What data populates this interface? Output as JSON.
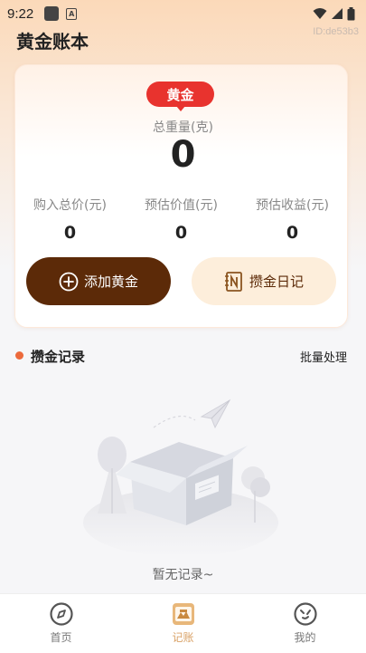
{
  "status_bar": {
    "time": "9:22",
    "badge": "A"
  },
  "header": {
    "title": "黄金账本",
    "id_text": "ID:de53b3"
  },
  "card": {
    "badge": "黄金",
    "weight_label": "总重量(克)",
    "weight_value": "0",
    "stats": [
      {
        "label": "购入总价(元)",
        "value": "0"
      },
      {
        "label": "预估价值(元)",
        "value": "0"
      },
      {
        "label": "预估收益(元)",
        "value": "0"
      }
    ],
    "add_button": "添加黄金",
    "diary_button": "攒金日记"
  },
  "records": {
    "title": "攒金记录",
    "batch_action": "批量处理",
    "empty_text": "暂无记录~"
  },
  "nav": [
    {
      "label": "首页",
      "icon": "compass-icon"
    },
    {
      "label": "记账",
      "icon": "ledger-icon"
    },
    {
      "label": "我的",
      "icon": "profile-face-icon"
    }
  ],
  "colors": {
    "accent": "#5c2a08",
    "badge": "#e8332e",
    "active_nav": "#d9a267",
    "dot": "#ec6a3c"
  }
}
